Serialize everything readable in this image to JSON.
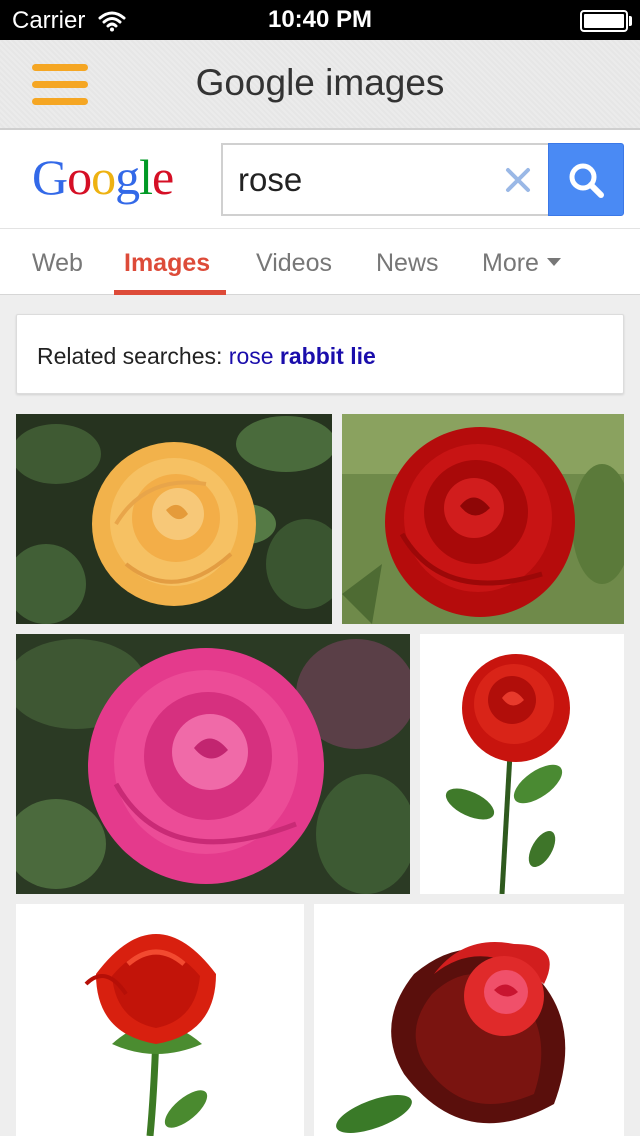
{
  "status_bar": {
    "carrier": "Carrier",
    "time": "10:40 PM"
  },
  "header": {
    "title": "Google images",
    "menu_color": "#f5a623"
  },
  "search": {
    "logo_letters": [
      {
        "ch": "G",
        "color": "#3369e8"
      },
      {
        "ch": "o",
        "color": "#d50f25"
      },
      {
        "ch": "o",
        "color": "#eeb211"
      },
      {
        "ch": "g",
        "color": "#3369e8"
      },
      {
        "ch": "l",
        "color": "#009925"
      },
      {
        "ch": "e",
        "color": "#d50f25"
      }
    ],
    "query": "rose",
    "button_color": "#4a8af4"
  },
  "tabs": {
    "web": "Web",
    "images": "Images",
    "videos": "Videos",
    "news": "News",
    "more": "More",
    "active": "Images",
    "active_color": "#dd4b39"
  },
  "related": {
    "label": "Related searches: ",
    "term_1": "rose",
    "term_2": "rabbit lie"
  },
  "results": [
    {
      "subject": "yellow-rose",
      "bg": "dark-leaves"
    },
    {
      "subject": "red-rose",
      "bg": "green"
    },
    {
      "subject": "pink-rose",
      "bg": "dark-leaves"
    },
    {
      "subject": "red-rose-stem",
      "bg": "white"
    },
    {
      "subject": "red-rose-bud",
      "bg": "white"
    },
    {
      "subject": "dark-red-rose",
      "bg": "white"
    }
  ]
}
